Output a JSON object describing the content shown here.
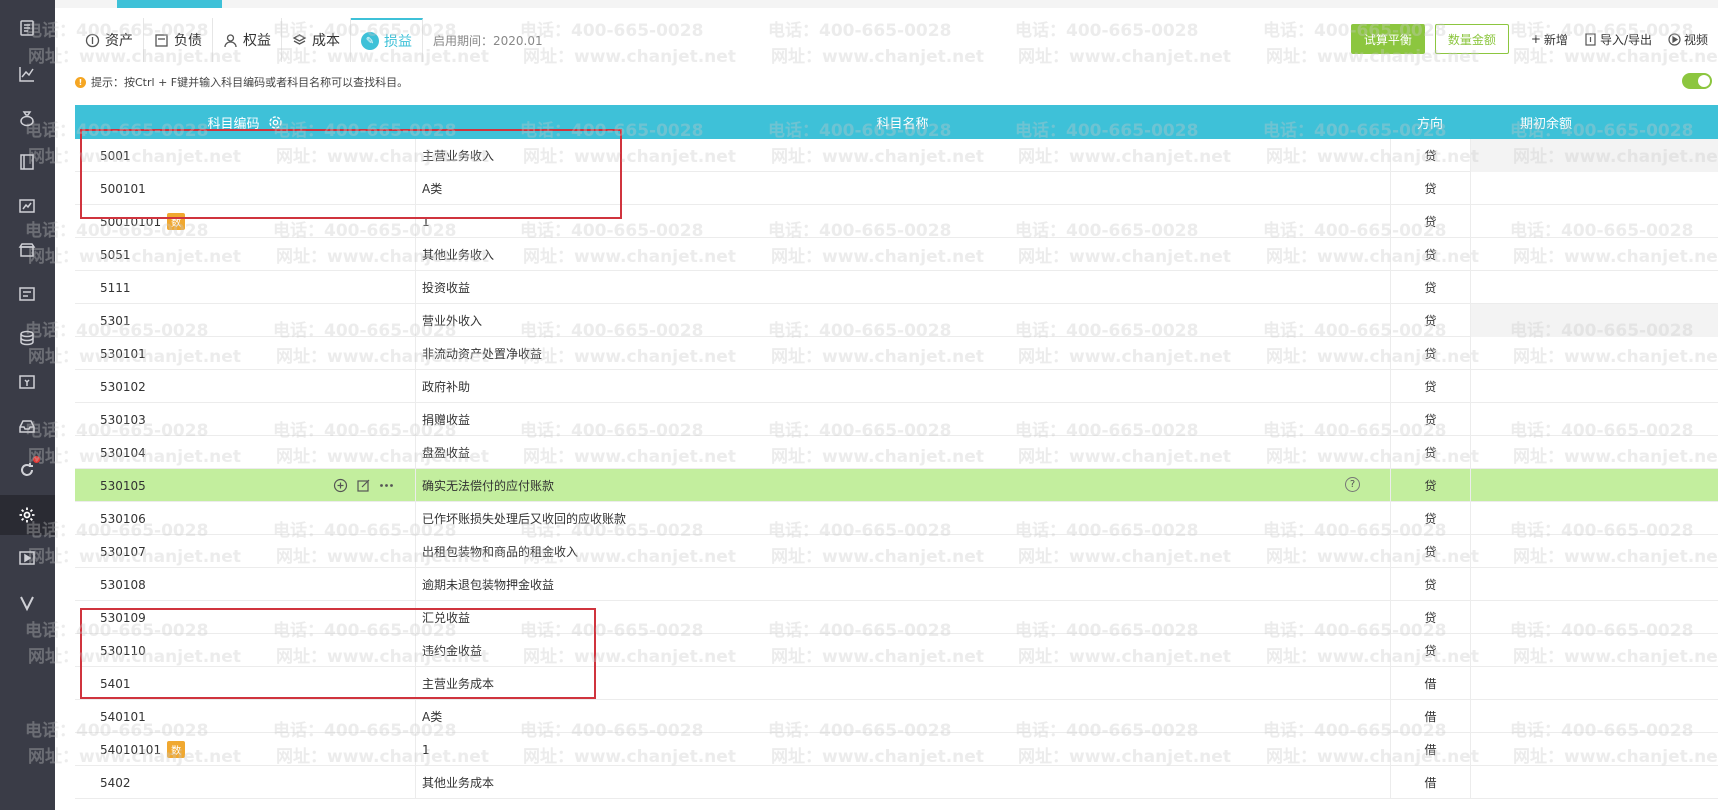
{
  "tabs": [
    {
      "label": "资产",
      "icon": "asset-icon"
    },
    {
      "label": "负债",
      "icon": "liability-icon"
    },
    {
      "label": "权益",
      "icon": "equity-icon"
    },
    {
      "label": "成本",
      "icon": "cost-icon"
    },
    {
      "label": "损益",
      "icon": "profit-loss-icon",
      "active": true
    }
  ],
  "period_text": "启用期间：2020.01",
  "toolbar": {
    "trial_balance": "试算平衡",
    "quantity_amount": "数量金额",
    "add": "新增",
    "import_export": "导入/导出",
    "video": "视频"
  },
  "hint": "提示：按Ctrl + F键并输入科目编码或者科目名称可以查找科目。",
  "toggle_on": true,
  "table": {
    "headers": {
      "code": "科目编码",
      "name": "科目名称",
      "direction": "方向",
      "balance": "期初余额"
    },
    "rows": [
      {
        "code": "5001",
        "name": "主营业务收入",
        "dir": "贷"
      },
      {
        "code": "500101",
        "name": "A类",
        "dir": "贷"
      },
      {
        "code": "50010101",
        "badge": "数",
        "name": "1",
        "dir": "贷"
      },
      {
        "code": "5051",
        "name": "其他业务收入",
        "dir": "贷"
      },
      {
        "code": "5111",
        "name": "投资收益",
        "dir": "贷"
      },
      {
        "code": "5301",
        "name": "营业外收入",
        "dir": "贷"
      },
      {
        "code": "530101",
        "name": "非流动资产处置净收益",
        "dir": "贷"
      },
      {
        "code": "530102",
        "name": "政府补助",
        "dir": "贷"
      },
      {
        "code": "530103",
        "name": "捐赠收益",
        "dir": "贷"
      },
      {
        "code": "530104",
        "name": "盘盈收益",
        "dir": "贷"
      },
      {
        "code": "530105",
        "name": "确实无法偿付的应付账款",
        "dir": "贷",
        "highlight": true
      },
      {
        "code": "530106",
        "name": "已作坏账损失处理后又收回的应收账款",
        "dir": "贷"
      },
      {
        "code": "530107",
        "name": "出租包装物和商品的租金收入",
        "dir": "贷"
      },
      {
        "code": "530108",
        "name": "逾期未退包装物押金收益",
        "dir": "贷"
      },
      {
        "code": "530109",
        "name": "汇兑收益",
        "dir": "贷"
      },
      {
        "code": "530110",
        "name": "违约金收益",
        "dir": "贷"
      },
      {
        "code": "5401",
        "name": "主营业务成本",
        "dir": "借"
      },
      {
        "code": "540101",
        "name": "A类",
        "dir": "借"
      },
      {
        "code": "54010101",
        "badge": "数",
        "name": "1",
        "dir": "借"
      },
      {
        "code": "5402",
        "name": "其他业务成本",
        "dir": "借"
      }
    ]
  },
  "watermark": {
    "phone": "电话：400-665-0028",
    "site": "网址：www.chanjet.net"
  },
  "sidebar_icons": [
    "voucher-icon",
    "chart-icon",
    "money-bag-icon",
    "ledger-icon",
    "report-icon",
    "store-icon",
    "invoice-icon",
    "coins-icon",
    "cashflow-icon",
    "inbox-icon",
    "refresh-icon",
    "settings-icon",
    "play-icon",
    "v-logo-icon"
  ]
}
